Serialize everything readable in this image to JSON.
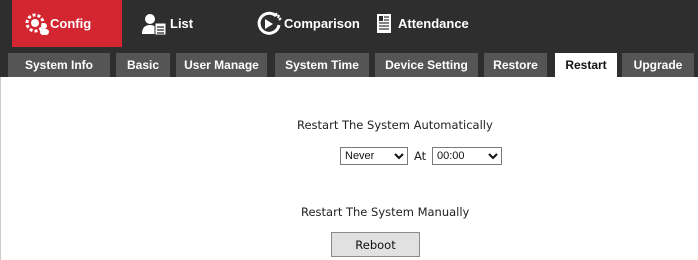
{
  "topnav": {
    "items": [
      {
        "label": "Config",
        "icon": "gear-people-icon",
        "active": true
      },
      {
        "label": "List",
        "icon": "user-list-icon",
        "active": false
      },
      {
        "label": "Comparison",
        "icon": "refresh-play-icon",
        "active": false
      },
      {
        "label": "Attendance",
        "icon": "document-icon",
        "active": false
      }
    ],
    "active_color": "#d42630",
    "bar_color": "#2e2e2e"
  },
  "tabs": [
    {
      "label": "System Info",
      "active": false
    },
    {
      "label": "Basic",
      "active": false
    },
    {
      "label": "User Manage",
      "active": false
    },
    {
      "label": "System Time",
      "active": false
    },
    {
      "label": "Device Setting",
      "active": false
    },
    {
      "label": "Restore",
      "active": false
    },
    {
      "label": "Restart",
      "active": true
    },
    {
      "label": "Upgrade",
      "active": false
    }
  ],
  "restart": {
    "auto_title": "Restart The System Automatically",
    "frequency_value": "Never",
    "at_label": "At",
    "time_value": "00:00",
    "manual_title": "Restart The System Manually",
    "reboot_label": "Reboot"
  }
}
